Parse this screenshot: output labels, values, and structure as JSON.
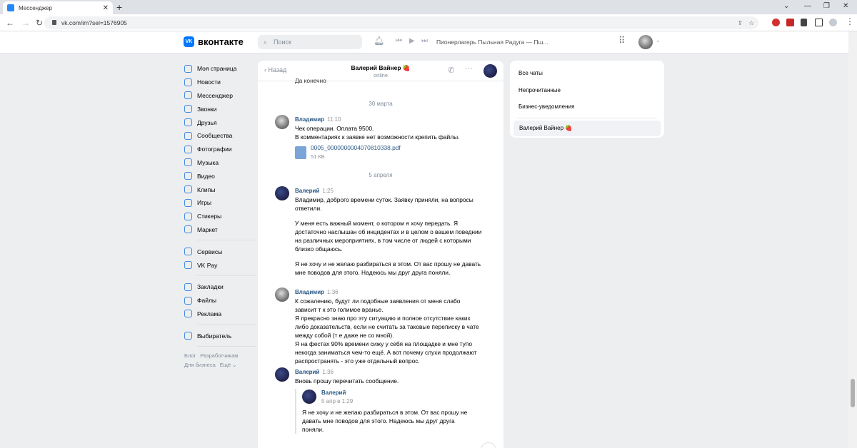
{
  "browser": {
    "tab_title": "Мессенджер",
    "url": "vk.com/im?sel=1576905"
  },
  "header": {
    "logo": "вконтакте",
    "logo_mark": "VK",
    "search_placeholder": "Поиск",
    "now_playing": "Пионерлагерь Пыльная Радуга — Пш..."
  },
  "sidebar": {
    "items": [
      {
        "label": "Моя страница"
      },
      {
        "label": "Новости"
      },
      {
        "label": "Мессенджер"
      },
      {
        "label": "Звонки"
      },
      {
        "label": "Друзья"
      },
      {
        "label": "Сообщества"
      },
      {
        "label": "Фотографии"
      },
      {
        "label": "Музыка"
      },
      {
        "label": "Видео"
      },
      {
        "label": "Клипы"
      },
      {
        "label": "Игры"
      },
      {
        "label": "Стикеры"
      },
      {
        "label": "Маркет"
      }
    ],
    "items2": [
      {
        "label": "Сервисы"
      },
      {
        "label": "VK Pay"
      }
    ],
    "items3": [
      {
        "label": "Закладки"
      },
      {
        "label": "Файлы"
      },
      {
        "label": "Реклама"
      }
    ],
    "items4": [
      {
        "label": "Выбиратель"
      }
    ],
    "footer": {
      "blog": "Блог",
      "dev": "Разработчикам",
      "biz": "Для бизнеса",
      "more": "Ещё ⌄"
    }
  },
  "chat": {
    "back": "Назад",
    "title": "Валерий Вайнер 🍓",
    "status": "online",
    "partial": "Да конечно",
    "date1": "30 марта",
    "date2": "5 апреля",
    "m1": {
      "name": "Владимир",
      "time": "11:10",
      "lines": [
        "Чек операции. Оплата 9500.",
        "В комментариях к заявке нет возможности крепить файлы."
      ],
      "file": "0005_0000000004070810338.pdf",
      "size": "51 КБ"
    },
    "m2": {
      "name": "Валерий",
      "time": "1:25",
      "p1": "Владимир, доброго времени суток. Заявку приняли, на вопросы ответили.",
      "p2": "У меня есть важный момент, о котором я хочу передать. Я достаточно наслышан об инцидентах и в целом о вашем поведнии на различных мероприятиях, в том числе от людей с которыми близко общаюсь.",
      "p3": "Я не хочу и не желаю разбираться в этом. От вас прошу не давать мне поводов для этого. Надеюсь мы друг друга поняли."
    },
    "m3": {
      "name": "Владимир",
      "time": "1:36",
      "text": "К сожалению, будут ли подобные заявления от меня слабо зависит т к это голимое вранье.\nЯ прекрасно знаю про эту ситуацию и полное отсутствие каких либо доказательств, если не считать за таковые переписку в чате между собой (т е даже не со мной).\nЯ на фестах 90% времени сижу у себя на площадке и мне тупо некогда заниматься чем-то ещё. А вот почему слухи продолжают распространять - это уже отдельный вопрос."
    },
    "m4": {
      "name": "Валерий",
      "time": "1:36",
      "text": "Вновь прошу перечитать сообщение.",
      "fwd_name": "Валерий",
      "fwd_time": "5 апр в 1:29",
      "fwd_text": "Я не хочу и не желаю разбираться в этом. От вас прошу не давать мне поводов для этого. Надеюсь мы друг друга поняли."
    }
  },
  "right": {
    "items": [
      "Все чаты",
      "Непрочитанные",
      "Бизнес-уведомления"
    ],
    "active": "Валерий Вайнер 🍓"
  }
}
